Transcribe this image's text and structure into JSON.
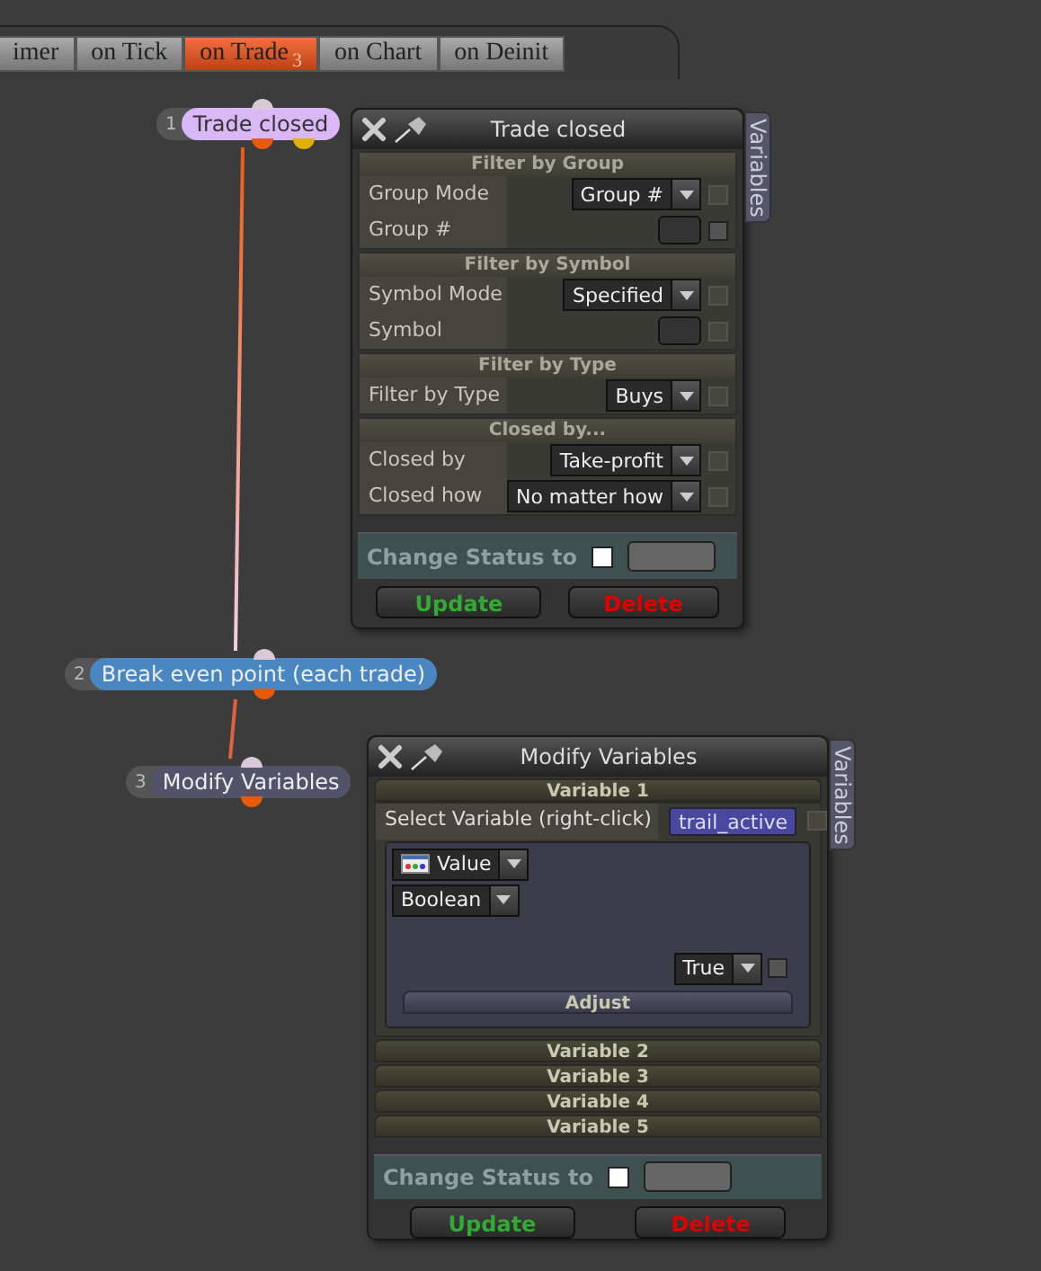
{
  "tabs": [
    {
      "label": "imer",
      "selected": false
    },
    {
      "label": "on Tick",
      "selected": false
    },
    {
      "label": "on Trade",
      "badge": "3",
      "selected": true
    },
    {
      "label": "on Chart",
      "selected": false
    },
    {
      "label": "on Deinit",
      "selected": false
    }
  ],
  "nodes": [
    {
      "number": "1",
      "label": "Trade closed",
      "color": "#d9b8f5"
    },
    {
      "number": "2",
      "label": "Break even point (each trade)",
      "color": "#4a87c2"
    },
    {
      "number": "3",
      "label": "Modify Variables",
      "color": "#52526a"
    }
  ],
  "panels": [
    {
      "title": "Trade closed",
      "side_tab": "Variables",
      "sections": [
        {
          "kind": "filter",
          "title": "Filter by Group",
          "rows": [
            {
              "label": "Group Mode",
              "kind": "dropdown",
              "value": "Group #",
              "checked": false,
              "disabled": true
            },
            {
              "label": "Group #",
              "kind": "field",
              "checked": false,
              "disabled": false
            }
          ]
        },
        {
          "kind": "filter",
          "title": "Filter by Symbol",
          "rows": [
            {
              "label": "Symbol Mode",
              "kind": "dropdown",
              "value": "Specified",
              "checked": false,
              "disabled": true
            },
            {
              "label": "Symbol",
              "kind": "field",
              "checked": false,
              "disabled": true
            }
          ]
        },
        {
          "kind": "filter",
          "title": "Filter by Type",
          "rows": [
            {
              "label": "Filter by Type",
              "kind": "dropdown",
              "value": "Buys",
              "checked": false,
              "disabled": true
            }
          ]
        },
        {
          "kind": "filter",
          "title": "Closed by...",
          "rows": [
            {
              "label": "Closed by",
              "kind": "dropdown",
              "value": "Take-profit",
              "checked": false,
              "disabled": true
            },
            {
              "label": "Closed how",
              "kind": "dropdown",
              "value": "No matter how",
              "checked": false,
              "disabled": true
            }
          ]
        }
      ],
      "status": {
        "label": "Change Status to",
        "checked": false
      },
      "buttons": [
        {
          "label": "Update",
          "kind": "update"
        },
        {
          "label": "Delete",
          "kind": "delete"
        }
      ]
    },
    {
      "title": "Modify Variables",
      "side_tab": "Variables",
      "sections": [
        {
          "kind": "variable",
          "title": "Variable 1",
          "expanded": true,
          "select_label": "Select Variable (right-click)",
          "chip": "trail_active",
          "chip_checked": false,
          "chip_disabled": true,
          "type_dropdowns": [
            {
              "value": "Value",
              "icon": true
            },
            {
              "value": "Boolean",
              "icon": false
            }
          ],
          "value_dropdown": "True",
          "value_checked": false,
          "button": "Adjust"
        },
        {
          "kind": "variable",
          "title": "Variable 2",
          "expanded": false
        },
        {
          "kind": "variable",
          "title": "Variable 3",
          "expanded": false
        },
        {
          "kind": "variable",
          "title": "Variable 4",
          "expanded": false
        },
        {
          "kind": "variable",
          "title": "Variable 5",
          "expanded": false
        }
      ],
      "status": {
        "label": "Change Status to",
        "checked": false
      },
      "buttons": [
        {
          "label": "Update",
          "kind": "update"
        },
        {
          "label": "Delete",
          "kind": "delete"
        }
      ]
    }
  ]
}
